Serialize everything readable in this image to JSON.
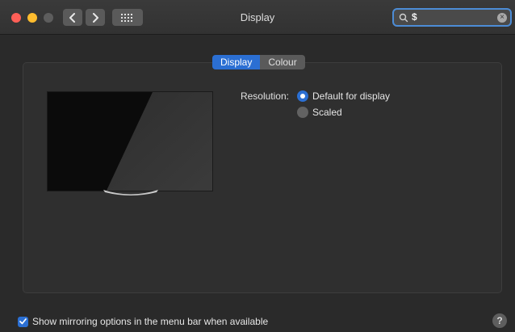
{
  "window": {
    "title": "Display"
  },
  "toolbar": {
    "back_icon": "chevron-left-icon",
    "forward_icon": "chevron-right-icon",
    "grid_icon": "grid-icon"
  },
  "search": {
    "value": "$",
    "icon": "search-icon",
    "clear_icon": "clear-icon"
  },
  "tabs": [
    {
      "label": "Display",
      "active": true
    },
    {
      "label": "Colour",
      "active": false
    }
  ],
  "resolution": {
    "label": "Resolution:",
    "options": [
      {
        "label": "Default for display",
        "selected": true
      },
      {
        "label": "Scaled",
        "selected": false
      }
    ]
  },
  "mirroring": {
    "label": "Show mirroring options in the menu bar when available",
    "checked": true
  },
  "help": {
    "label": "?"
  },
  "colors": {
    "accent": "#2b6fd3",
    "close": "#fe5f57",
    "minimize": "#febc2e",
    "background": "#2a2a2a"
  }
}
